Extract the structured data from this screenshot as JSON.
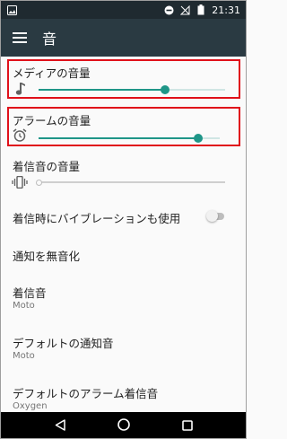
{
  "status_bar": {
    "time": "21:31",
    "icons": [
      "image-notification-icon",
      "do-not-disturb-icon",
      "no-signal-icon",
      "battery-icon"
    ]
  },
  "app_bar": {
    "title": "音",
    "menu_icon": "hamburger-menu-icon"
  },
  "settings": {
    "media_volume": {
      "title": "メディアの音量",
      "icon": "music-note-icon",
      "level_percent": 68
    },
    "alarm_volume": {
      "title": "アラームの音量",
      "icon": "alarm-clock-icon",
      "level_percent": 88
    },
    "ring_volume": {
      "title": "着信音の音量",
      "icon": "vibrate-icon",
      "level_percent": 0
    },
    "vibrate_on_ring": {
      "title": "着信時にバイブレーションも使用",
      "enabled": false
    },
    "dnd": {
      "title": "通知を無音化"
    },
    "ringtone": {
      "title": "着信音",
      "value": "Moto"
    },
    "default_notification": {
      "title": "デフォルトの通知音",
      "value": "Moto"
    },
    "default_alarm": {
      "title": "デフォルトのアラーム着信音",
      "value": "Oxygen"
    }
  },
  "nav_bar": {
    "icons": [
      "back-icon",
      "home-icon",
      "recents-icon"
    ]
  },
  "colors": {
    "status_bar": "#1f2a30",
    "app_bar": "#2a3a42",
    "accent": "#1f9688",
    "highlight": "#e0101a"
  }
}
